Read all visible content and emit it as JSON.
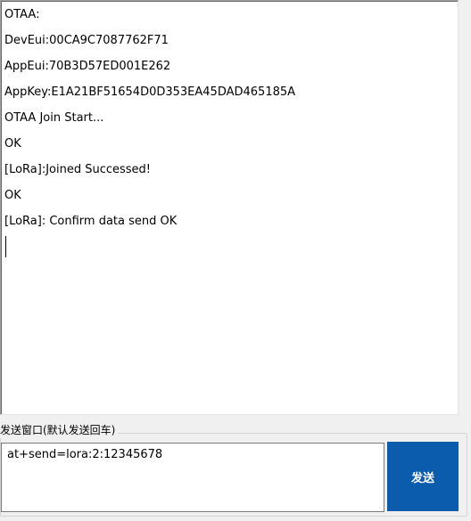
{
  "receive_area": {
    "lines": [
      "OTAA:",
      "DevEui:00CA9C7087762F71",
      "AppEui:70B3D57ED001E262",
      "AppKey:E1A21BF51654D0D353EA45DAD465185A",
      "OTAA Join Start...",
      "OK",
      "[LoRa]:Joined Successed!",
      "OK",
      "[LoRa]: Confirm data send OK"
    ]
  },
  "send_group": {
    "caption": "发送窗口(默认发送回车)",
    "input_value": "at+send=lora:2:12345678",
    "send_label": "发送"
  },
  "colors": {
    "send_button_bg": "#0b5cad",
    "send_button_text": "#ffffff",
    "window_bg": "#f0f0f0"
  }
}
